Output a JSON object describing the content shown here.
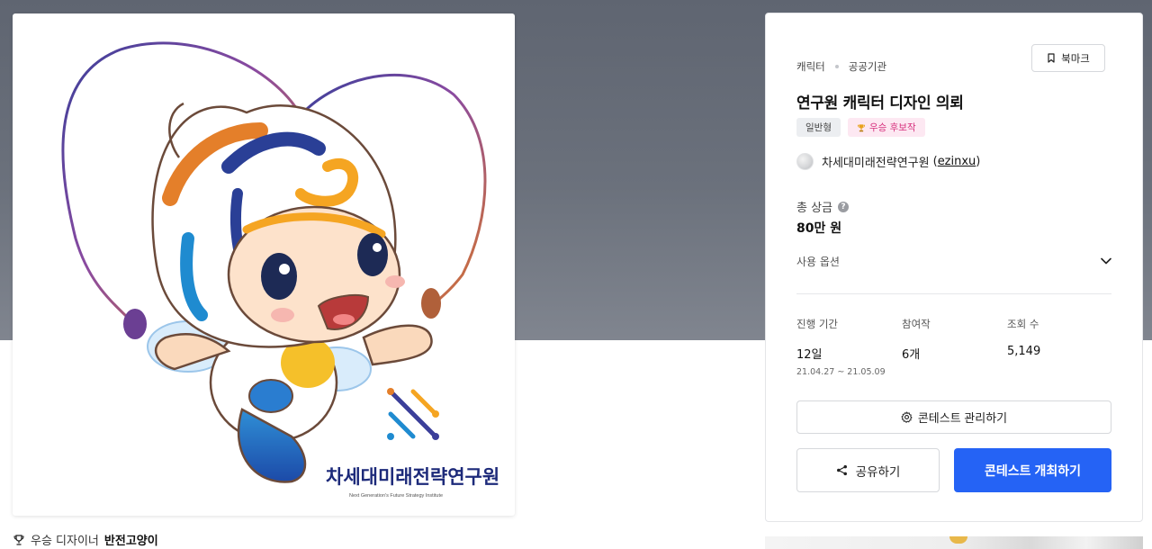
{
  "contest": {
    "breadcrumb": [
      "캐릭터",
      "공공기관"
    ],
    "bookmark_label": "북마크",
    "title": "연구원 캐릭터 디자인 의뢰",
    "badges": {
      "type": "일반형",
      "award": "우승 후보작"
    },
    "host": {
      "name": "차세대미래전략연구원",
      "handle": "ezinxu"
    },
    "prize": {
      "label": "총 상금",
      "value": "80만 원",
      "help_icon": "?"
    },
    "usage_label": "사용 옵션",
    "stats": [
      {
        "label": "진행 기간",
        "value": "12일",
        "sub": "21.04.27 ~ 21.05.09"
      },
      {
        "label": "참여작",
        "value": "6개"
      },
      {
        "label": "조회 수",
        "value": "5,149"
      }
    ],
    "manage_label": "콘테스트 관리하기",
    "share_label": "공유하기",
    "host_contest_label": "콘테스트 개최하기"
  },
  "artwork": {
    "org_name": "차세대미래전략연구원",
    "org_name_en": "Next Generation's Future Strategy Institute"
  },
  "winner": {
    "prefix": "우승 디자이너",
    "name": "반전고양이"
  },
  "colors": {
    "accent": "#2563f5",
    "hero_bg": "#656b76",
    "award_text": "#d6307d",
    "award_bg": "#fde8f2"
  },
  "icons": [
    "bookmark-icon",
    "trophy-icon",
    "help-icon",
    "chevron-down-icon",
    "gear-icon",
    "share-icon"
  ]
}
